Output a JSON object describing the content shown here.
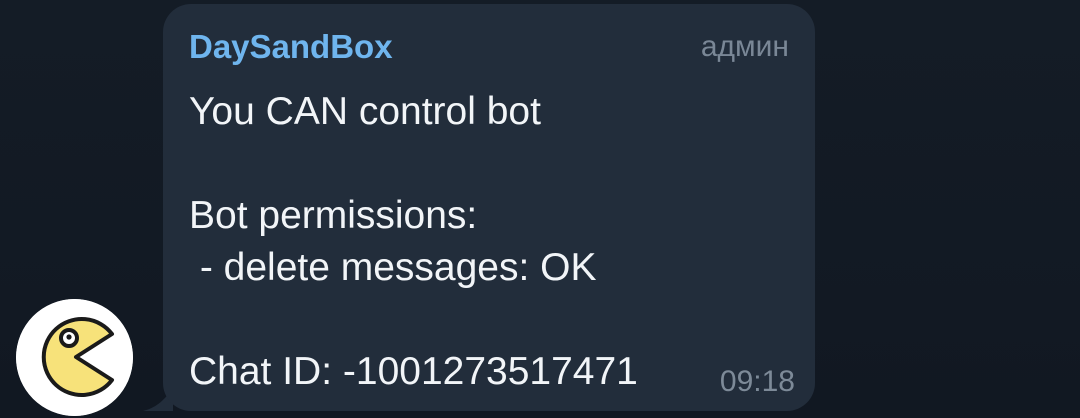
{
  "message": {
    "sender": "DaySandBox",
    "role": "админ",
    "lines": [
      "You CAN control bot",
      "",
      "Bot permissions:",
      " - delete messages: OK",
      "",
      "Chat ID: -1001273517471"
    ],
    "time": "09:18"
  },
  "avatar": {
    "icon": "pacman-avatar-icon"
  },
  "colors": {
    "background": "#121a24",
    "bubble": "#222d3b",
    "sender": "#6fb5ee",
    "text": "#f2f5f8",
    "muted": "#7a8796",
    "avatar_face": "#f7e27a"
  }
}
